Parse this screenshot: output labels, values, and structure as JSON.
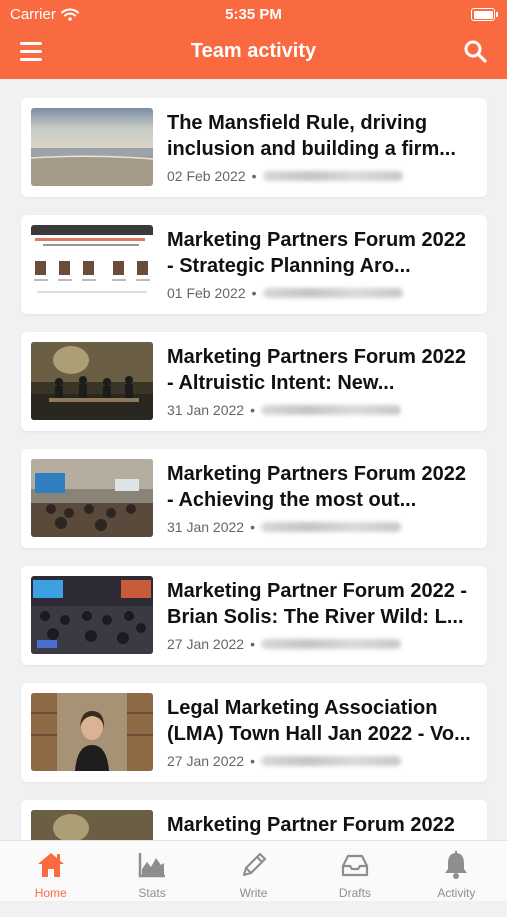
{
  "status": {
    "carrier": "Carrier",
    "time": "5:35 PM"
  },
  "header": {
    "title": "Team activity"
  },
  "brand_color": "#fa6a40",
  "posts": [
    {
      "title": "The Mansfield Rule, driving inclusion and building a firm...",
      "date": "02 Feb 2022",
      "sep": "•",
      "thumb": "beach"
    },
    {
      "title": "Marketing Partners Forum 2022 - Strategic Planning Aro...",
      "date": "01 Feb 2022",
      "sep": "•",
      "thumb": "slide"
    },
    {
      "title": "Marketing Partners Forum 2022 - Altruistic Intent: New...",
      "date": "31 Jan 2022",
      "sep": "•",
      "thumb": "panel"
    },
    {
      "title": "Marketing Partners Forum 2022 - Achieving the most out...",
      "date": "31 Jan 2022",
      "sep": "•",
      "thumb": "conference"
    },
    {
      "title": "Marketing Partner Forum 2022 - Brian Solis: The River Wild: L...",
      "date": "27 Jan 2022",
      "sep": "•",
      "thumb": "audience"
    },
    {
      "title": "Legal Marketing Association (LMA) Town Hall Jan 2022 - Vo...",
      "date": "27 Jan 2022",
      "sep": "•",
      "thumb": "speaker"
    },
    {
      "title": "Marketing Partner Forum 2022",
      "date": "",
      "sep": "",
      "thumb": "panel"
    }
  ],
  "tabs": [
    {
      "label": "Home",
      "icon": "home-icon",
      "active": true
    },
    {
      "label": "Stats",
      "icon": "stats-icon",
      "active": false
    },
    {
      "label": "Write",
      "icon": "pencil-icon",
      "active": false
    },
    {
      "label": "Drafts",
      "icon": "inbox-icon",
      "active": false
    },
    {
      "label": "Activity",
      "icon": "bell-icon",
      "active": false
    }
  ]
}
